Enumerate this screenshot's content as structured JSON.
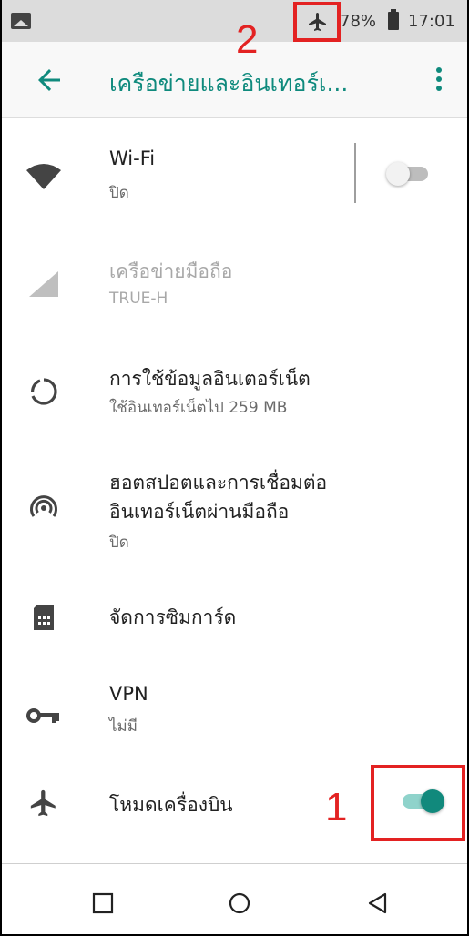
{
  "status_bar": {
    "battery_percent": "78%",
    "time": "17:01",
    "icons": [
      "image-icon",
      "airplane-icon",
      "battery-icon"
    ]
  },
  "app_bar": {
    "title": "เครือข่ายและอินเทอร์เ...",
    "back_icon": "arrow-left-icon",
    "menu_icon": "more-vert-icon"
  },
  "items": [
    {
      "title": "Wi-Fi",
      "subtitle": "ปิด",
      "icon": "wifi-icon",
      "toggle": "off"
    },
    {
      "title": "เครือข่ายมือถือ",
      "subtitle": "TRUE-H",
      "icon": "cell-signal-icon",
      "disabled": true
    },
    {
      "title": "การใช้ข้อมูลอินเตอร์เน็ต",
      "subtitle": "ใช้อินเทอร์เน็ตไป 259 MB",
      "icon": "data-usage-icon"
    },
    {
      "title_line1": "ฮอตสปอตและการเชื่อมต่อ",
      "title_line2": "อินเทอร์เน็ตผ่านมือถือ",
      "subtitle": "ปิด",
      "icon": "hotspot-icon"
    },
    {
      "title": "จัดการซิมการ์ด",
      "icon": "sim-card-icon"
    },
    {
      "title": "VPN",
      "subtitle": "ไม่มี",
      "icon": "vpn-key-icon"
    },
    {
      "title": "โหมดเครื่องบิน",
      "icon": "airplane-icon",
      "toggle": "on"
    }
  ],
  "annotations": {
    "label_1": "1",
    "label_2": "2",
    "color": "#e32222"
  },
  "nav_bar": [
    "recents-square-icon",
    "home-circle-icon",
    "back-triangle-icon"
  ],
  "colors": {
    "accent": "#11897c",
    "status_bar_bg": "#dcdcdc"
  }
}
